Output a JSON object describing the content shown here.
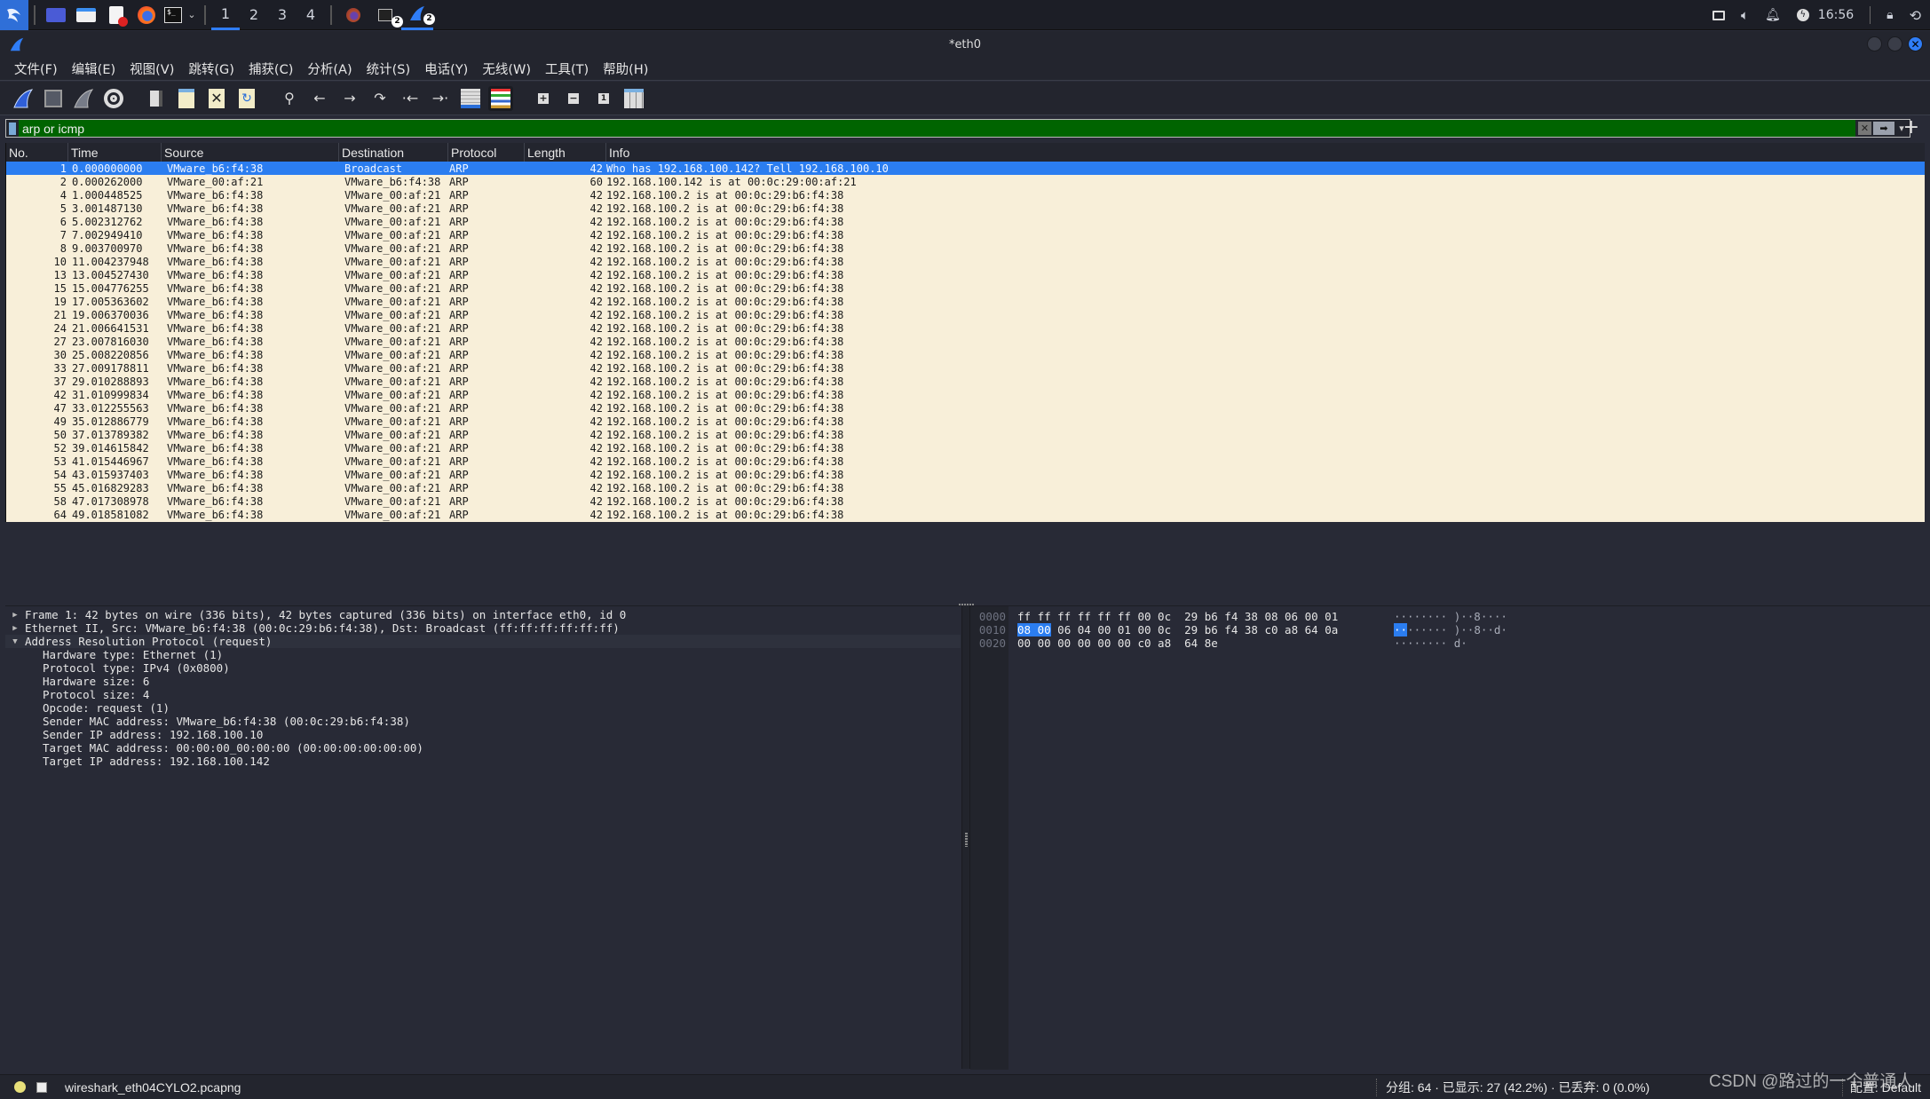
{
  "taskbar": {
    "apps": [
      {
        "name": "kali-menu",
        "icon": "kali-dragon-icon"
      },
      {
        "name": "show-desktop",
        "icon": "desktop-icon"
      },
      {
        "name": "file-manager",
        "icon": "folder-icon"
      },
      {
        "name": "text-editor",
        "icon": "text-editor-icon"
      },
      {
        "name": "firefox",
        "icon": "firefox-icon"
      },
      {
        "name": "terminal",
        "icon": "terminal-icon"
      }
    ],
    "workspaces": [
      "1",
      "2",
      "3",
      "4"
    ],
    "active_workspace": "1",
    "windows": [
      {
        "name": "firefox",
        "icon": "firefox-icon",
        "count": ""
      },
      {
        "name": "terminal",
        "icon": "terminal-icon",
        "count": "2"
      },
      {
        "name": "wireshark",
        "icon": "wireshark-fin-icon",
        "count": "2"
      }
    ],
    "tray": {
      "clock": "16:56"
    }
  },
  "window": {
    "title": "*eth0"
  },
  "menubar": {
    "items": [
      "文件(F)",
      "编辑(E)",
      "视图(V)",
      "跳转(G)",
      "捕获(C)",
      "分析(A)",
      "统计(S)",
      "电话(Y)",
      "无线(W)",
      "工具(T)",
      "帮助(H)"
    ]
  },
  "toolbar": {
    "buttons": [
      {
        "name": "start-capture",
        "icon": "shark-fin-icon"
      },
      {
        "name": "stop-capture",
        "icon": "stop-square-icon"
      },
      {
        "name": "restart-capture",
        "icon": "restart-fin-icon"
      },
      {
        "name": "capture-options",
        "icon": "gear-icon"
      },
      {
        "name": "open-file",
        "icon": "open-file-icon"
      },
      {
        "name": "save-file",
        "icon": "save-file-icon"
      },
      {
        "name": "close-file",
        "icon": "close-file-icon"
      },
      {
        "name": "reload-file",
        "icon": "reload-file-icon"
      },
      {
        "name": "find-packet",
        "icon": "search-icon"
      },
      {
        "name": "go-back",
        "icon": "arrow-left-icon"
      },
      {
        "name": "go-forward",
        "icon": "arrow-right-icon"
      },
      {
        "name": "go-to-packet",
        "icon": "jump-icon"
      },
      {
        "name": "first-packet",
        "icon": "first-packet-icon"
      },
      {
        "name": "last-packet",
        "icon": "last-packet-icon"
      },
      {
        "name": "auto-scroll",
        "icon": "auto-scroll-icon"
      },
      {
        "name": "colorize",
        "icon": "colorize-icon"
      },
      {
        "name": "zoom-in",
        "icon": "zoom-in-icon"
      },
      {
        "name": "zoom-out",
        "icon": "zoom-out-icon"
      },
      {
        "name": "normal-size",
        "icon": "normal-size-icon"
      },
      {
        "name": "resize-columns",
        "icon": "resize-columns-icon"
      }
    ]
  },
  "filter": {
    "value": "arp or icmp",
    "bg_color": "#006400"
  },
  "packet_list": {
    "columns": [
      "No.",
      "Time",
      "Source",
      "Destination",
      "Protocol",
      "Length",
      "Info"
    ],
    "selected_index": 0,
    "rows": [
      {
        "no": "1",
        "time": "0.000000000",
        "src": "VMware_b6:f4:38",
        "dst": "Broadcast",
        "proto": "ARP",
        "len": "42",
        "info": "Who has 192.168.100.142? Tell 192.168.100.10"
      },
      {
        "no": "2",
        "time": "0.000262000",
        "src": "VMware_00:af:21",
        "dst": "VMware_b6:f4:38",
        "proto": "ARP",
        "len": "60",
        "info": "192.168.100.142 is at 00:0c:29:00:af:21"
      },
      {
        "no": "4",
        "time": "1.000448525",
        "src": "VMware_b6:f4:38",
        "dst": "VMware_00:af:21",
        "proto": "ARP",
        "len": "42",
        "info": "192.168.100.2 is at 00:0c:29:b6:f4:38"
      },
      {
        "no": "5",
        "time": "3.001487130",
        "src": "VMware_b6:f4:38",
        "dst": "VMware_00:af:21",
        "proto": "ARP",
        "len": "42",
        "info": "192.168.100.2 is at 00:0c:29:b6:f4:38"
      },
      {
        "no": "6",
        "time": "5.002312762",
        "src": "VMware_b6:f4:38",
        "dst": "VMware_00:af:21",
        "proto": "ARP",
        "len": "42",
        "info": "192.168.100.2 is at 00:0c:29:b6:f4:38"
      },
      {
        "no": "7",
        "time": "7.002949410",
        "src": "VMware_b6:f4:38",
        "dst": "VMware_00:af:21",
        "proto": "ARP",
        "len": "42",
        "info": "192.168.100.2 is at 00:0c:29:b6:f4:38"
      },
      {
        "no": "8",
        "time": "9.003700970",
        "src": "VMware_b6:f4:38",
        "dst": "VMware_00:af:21",
        "proto": "ARP",
        "len": "42",
        "info": "192.168.100.2 is at 00:0c:29:b6:f4:38"
      },
      {
        "no": "10",
        "time": "11.004237948",
        "src": "VMware_b6:f4:38",
        "dst": "VMware_00:af:21",
        "proto": "ARP",
        "len": "42",
        "info": "192.168.100.2 is at 00:0c:29:b6:f4:38"
      },
      {
        "no": "13",
        "time": "13.004527430",
        "src": "VMware_b6:f4:38",
        "dst": "VMware_00:af:21",
        "proto": "ARP",
        "len": "42",
        "info": "192.168.100.2 is at 00:0c:29:b6:f4:38"
      },
      {
        "no": "15",
        "time": "15.004776255",
        "src": "VMware_b6:f4:38",
        "dst": "VMware_00:af:21",
        "proto": "ARP",
        "len": "42",
        "info": "192.168.100.2 is at 00:0c:29:b6:f4:38"
      },
      {
        "no": "19",
        "time": "17.005363602",
        "src": "VMware_b6:f4:38",
        "dst": "VMware_00:af:21",
        "proto": "ARP",
        "len": "42",
        "info": "192.168.100.2 is at 00:0c:29:b6:f4:38"
      },
      {
        "no": "21",
        "time": "19.006370036",
        "src": "VMware_b6:f4:38",
        "dst": "VMware_00:af:21",
        "proto": "ARP",
        "len": "42",
        "info": "192.168.100.2 is at 00:0c:29:b6:f4:38"
      },
      {
        "no": "24",
        "time": "21.006641531",
        "src": "VMware_b6:f4:38",
        "dst": "VMware_00:af:21",
        "proto": "ARP",
        "len": "42",
        "info": "192.168.100.2 is at 00:0c:29:b6:f4:38"
      },
      {
        "no": "27",
        "time": "23.007816030",
        "src": "VMware_b6:f4:38",
        "dst": "VMware_00:af:21",
        "proto": "ARP",
        "len": "42",
        "info": "192.168.100.2 is at 00:0c:29:b6:f4:38"
      },
      {
        "no": "30",
        "time": "25.008220856",
        "src": "VMware_b6:f4:38",
        "dst": "VMware_00:af:21",
        "proto": "ARP",
        "len": "42",
        "info": "192.168.100.2 is at 00:0c:29:b6:f4:38"
      },
      {
        "no": "33",
        "time": "27.009178811",
        "src": "VMware_b6:f4:38",
        "dst": "VMware_00:af:21",
        "proto": "ARP",
        "len": "42",
        "info": "192.168.100.2 is at 00:0c:29:b6:f4:38"
      },
      {
        "no": "37",
        "time": "29.010288893",
        "src": "VMware_b6:f4:38",
        "dst": "VMware_00:af:21",
        "proto": "ARP",
        "len": "42",
        "info": "192.168.100.2 is at 00:0c:29:b6:f4:38"
      },
      {
        "no": "42",
        "time": "31.010999834",
        "src": "VMware_b6:f4:38",
        "dst": "VMware_00:af:21",
        "proto": "ARP",
        "len": "42",
        "info": "192.168.100.2 is at 00:0c:29:b6:f4:38"
      },
      {
        "no": "47",
        "time": "33.012255563",
        "src": "VMware_b6:f4:38",
        "dst": "VMware_00:af:21",
        "proto": "ARP",
        "len": "42",
        "info": "192.168.100.2 is at 00:0c:29:b6:f4:38"
      },
      {
        "no": "49",
        "time": "35.012886779",
        "src": "VMware_b6:f4:38",
        "dst": "VMware_00:af:21",
        "proto": "ARP",
        "len": "42",
        "info": "192.168.100.2 is at 00:0c:29:b6:f4:38"
      },
      {
        "no": "50",
        "time": "37.013789382",
        "src": "VMware_b6:f4:38",
        "dst": "VMware_00:af:21",
        "proto": "ARP",
        "len": "42",
        "info": "192.168.100.2 is at 00:0c:29:b6:f4:38"
      },
      {
        "no": "52",
        "time": "39.014615842",
        "src": "VMware_b6:f4:38",
        "dst": "VMware_00:af:21",
        "proto": "ARP",
        "len": "42",
        "info": "192.168.100.2 is at 00:0c:29:b6:f4:38"
      },
      {
        "no": "53",
        "time": "41.015446967",
        "src": "VMware_b6:f4:38",
        "dst": "VMware_00:af:21",
        "proto": "ARP",
        "len": "42",
        "info": "192.168.100.2 is at 00:0c:29:b6:f4:38"
      },
      {
        "no": "54",
        "time": "43.015937403",
        "src": "VMware_b6:f4:38",
        "dst": "VMware_00:af:21",
        "proto": "ARP",
        "len": "42",
        "info": "192.168.100.2 is at 00:0c:29:b6:f4:38"
      },
      {
        "no": "55",
        "time": "45.016829283",
        "src": "VMware_b6:f4:38",
        "dst": "VMware_00:af:21",
        "proto": "ARP",
        "len": "42",
        "info": "192.168.100.2 is at 00:0c:29:b6:f4:38"
      },
      {
        "no": "58",
        "time": "47.017308978",
        "src": "VMware_b6:f4:38",
        "dst": "VMware_00:af:21",
        "proto": "ARP",
        "len": "42",
        "info": "192.168.100.2 is at 00:0c:29:b6:f4:38"
      },
      {
        "no": "64",
        "time": "49.018581082",
        "src": "VMware_b6:f4:38",
        "dst": "VMware_00:af:21",
        "proto": "ARP",
        "len": "42",
        "info": "192.168.100.2 is at 00:0c:29:b6:f4:38"
      }
    ]
  },
  "packet_details": {
    "tree": [
      {
        "label": "Frame 1: 42 bytes on wire (336 bits), 42 bytes captured (336 bits) on interface eth0, id 0",
        "expanded": false,
        "children": []
      },
      {
        "label": "Ethernet II, Src: VMware_b6:f4:38 (00:0c:29:b6:f4:38), Dst: Broadcast (ff:ff:ff:ff:ff:ff)",
        "expanded": false,
        "children": []
      },
      {
        "label": "Address Resolution Protocol (request)",
        "expanded": true,
        "children": [
          "Hardware type: Ethernet (1)",
          "Protocol type: IPv4 (0x0800)",
          "Hardware size: 6",
          "Protocol size: 4",
          "Opcode: request (1)",
          "Sender MAC address: VMware_b6:f4:38 (00:0c:29:b6:f4:38)",
          "Sender IP address: 192.168.100.10",
          "Target MAC address: 00:00:00_00:00:00 (00:00:00:00:00:00)",
          "Target IP address: 192.168.100.142"
        ]
      }
    ]
  },
  "packet_bytes": {
    "rows": [
      {
        "offset": "0000",
        "hex_pre": "",
        "hex_hl": "",
        "hex_post": "ff ff ff ff ff ff 00 0c  29 b6 f4 38 08 06 00 01",
        "ascii_hl": "",
        "ascii_post": "········ )··8····"
      },
      {
        "offset": "0010",
        "hex_pre": "",
        "hex_hl": "08 00",
        "hex_post": " 06 04 00 01 00 0c  29 b6 f4 38 c0 a8 64 0a",
        "ascii_hl": "··",
        "ascii_post": "······ )··8··d·"
      },
      {
        "offset": "0020",
        "hex_pre": "",
        "hex_hl": "",
        "hex_post": "00 00 00 00 00 00 c0 a8  64 8e",
        "ascii_hl": "",
        "ascii_post": "········ d·"
      }
    ]
  },
  "statusbar": {
    "file": "wireshark_eth04CYLO2.pcapng",
    "stats": "分组: 64 · 已显示: 27 (42.2%) · 已丢弃: 0 (0.0%)",
    "profile": "配置: Default"
  },
  "watermark": "CSDN @路过的一个普通人"
}
